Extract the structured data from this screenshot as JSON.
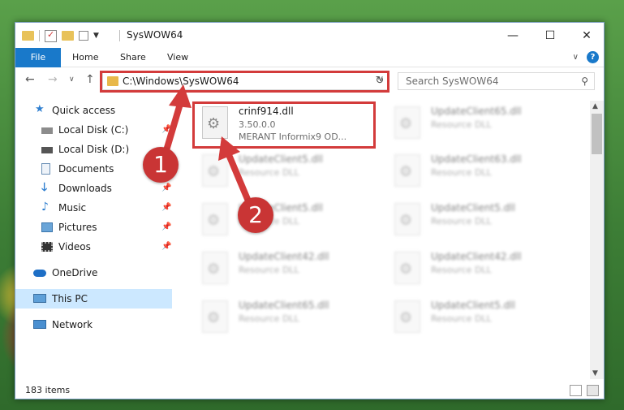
{
  "window": {
    "title": "SysWOW64",
    "controls": {
      "minimize": "—",
      "maximize": "☐",
      "close": "✕"
    }
  },
  "ribbon": {
    "tabs": [
      "File",
      "Home",
      "Share",
      "View"
    ],
    "chevron": "∨"
  },
  "nav": {
    "back": "←",
    "forward": "→",
    "recent": "∨",
    "up": "↑"
  },
  "address": {
    "path": "C:\\Windows\\SysWOW64",
    "refresh": "↻"
  },
  "search": {
    "placeholder": "Search SysWOW64"
  },
  "sidebar": {
    "items": [
      {
        "label": "Quick access"
      },
      {
        "label": "Local Disk (C:)"
      },
      {
        "label": "Local Disk (D:)"
      },
      {
        "label": "Documents"
      },
      {
        "label": "Downloads"
      },
      {
        "label": "Music"
      },
      {
        "label": "Pictures"
      },
      {
        "label": "Videos"
      },
      {
        "label": "OneDrive"
      },
      {
        "label": "This PC"
      },
      {
        "label": "Network"
      }
    ]
  },
  "files": [
    {
      "name": "crinf914.dll",
      "line1": "3.50.0.0",
      "line2": "MERANT Informix9 OD..."
    },
    {
      "name": "UpdateClient65.dll",
      "line1": "Resource DLL",
      "line2": ""
    },
    {
      "name": "UpdateClient5.dll",
      "line1": "Resource DLL",
      "line2": ""
    },
    {
      "name": "UpdateClient63.dll",
      "line1": "Resource DLL",
      "line2": ""
    },
    {
      "name": "UpdateClient5.dll",
      "line1": "Resource DLL",
      "line2": ""
    },
    {
      "name": "UpdateClient5.dll",
      "line1": "Resource DLL",
      "line2": ""
    },
    {
      "name": "UpdateClient42.dll",
      "line1": "Resource DLL",
      "line2": ""
    },
    {
      "name": "UpdateClient42.dll",
      "line1": "Resource DLL",
      "line2": ""
    },
    {
      "name": "UpdateClient65.dll",
      "line1": "Resource DLL",
      "line2": ""
    },
    {
      "name": "UpdateClient5.dll",
      "line1": "Resource DLL",
      "line2": ""
    }
  ],
  "status": {
    "count": "183 items"
  },
  "annotations": {
    "step1": "1",
    "step2": "2"
  },
  "colors": {
    "accent": "#1979ca",
    "highlight": "#d33b3b",
    "selection": "#cce8ff"
  }
}
